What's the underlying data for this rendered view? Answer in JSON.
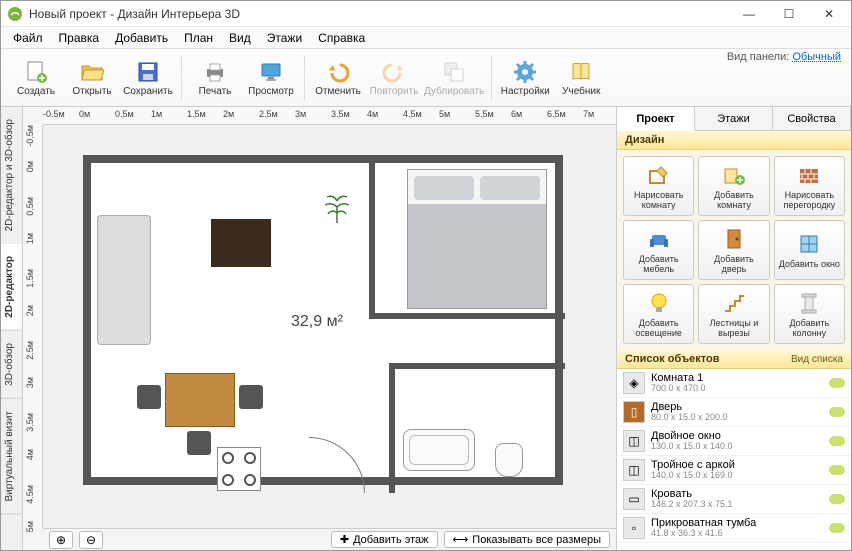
{
  "title": "Новый проект - Дизайн Интерьера 3D",
  "window": {
    "min": "—",
    "max": "☐",
    "close": "✕"
  },
  "menu": [
    "Файл",
    "Правка",
    "Добавить",
    "План",
    "Вид",
    "Этажи",
    "Справка"
  ],
  "toolbar": {
    "create": "Создать",
    "open": "Открыть",
    "save": "Сохранить",
    "print": "Печать",
    "view": "Просмотр",
    "undo": "Отменить",
    "redo": "Повторить",
    "duplicate": "Дублировать",
    "settings": "Настройки",
    "manual": "Учебник"
  },
  "panel_mode_label": "Вид панели:",
  "panel_mode_value": "Обычный",
  "vtabs": {
    "combo": "2D-редактор и 3D-обзор",
    "edit2d": "2D-редактор",
    "view3d": "3D-обзор",
    "virtual": "Виртуальный визит"
  },
  "ruler_h": [
    "-0.5м",
    "0м",
    "0.5м",
    "1м",
    "1.5м",
    "2м",
    "2.5м",
    "3м",
    "3.5м",
    "4м",
    "4.5м",
    "5м",
    "5.5м",
    "6м",
    "6.5м",
    "7м"
  ],
  "ruler_v": [
    "-0.5м",
    "0м",
    "0.5м",
    "1м",
    "1.5м",
    "2м",
    "2.5м",
    "3м",
    "3.5м",
    "4м",
    "4.5м",
    "5м"
  ],
  "area_label": "32,9 м²",
  "bottom": {
    "zoom_in": "⊕",
    "zoom_out": "⊖",
    "add_floor": "Добавить этаж",
    "show_all": "Показывать все размеры"
  },
  "rtabs": [
    "Проект",
    "Этажи",
    "Свойства"
  ],
  "design_head": "Дизайн",
  "tools": [
    "Нарисовать комнату",
    "Добавить комнату",
    "Нарисовать перегородку",
    "Добавить мебель",
    "Добавить дверь",
    "Добавить окно",
    "Добавить освещение",
    "Лестницы и вырезы",
    "Добавить колонну"
  ],
  "objlist_head": "Список объектов",
  "objlist_sub": "Вид списка",
  "objects": [
    {
      "name": "Комната 1",
      "dim": "700.0 x 470.0",
      "icon": "◈"
    },
    {
      "name": "Дверь",
      "dim": "80.0 x 15.0 x 200.0",
      "icon": "▯"
    },
    {
      "name": "Двойное окно",
      "dim": "130.0 x 15.0 x 140.0",
      "icon": "◫"
    },
    {
      "name": "Тройное с аркой",
      "dim": "140.0 x 15.0 x 169.0",
      "icon": "◫"
    },
    {
      "name": "Кровать",
      "dim": "146.2 x 207.3 x 75.1",
      "icon": "▭"
    },
    {
      "name": "Прикроватная тумба",
      "dim": "41.8 x 36.3 x 41.6",
      "icon": "▫"
    }
  ]
}
